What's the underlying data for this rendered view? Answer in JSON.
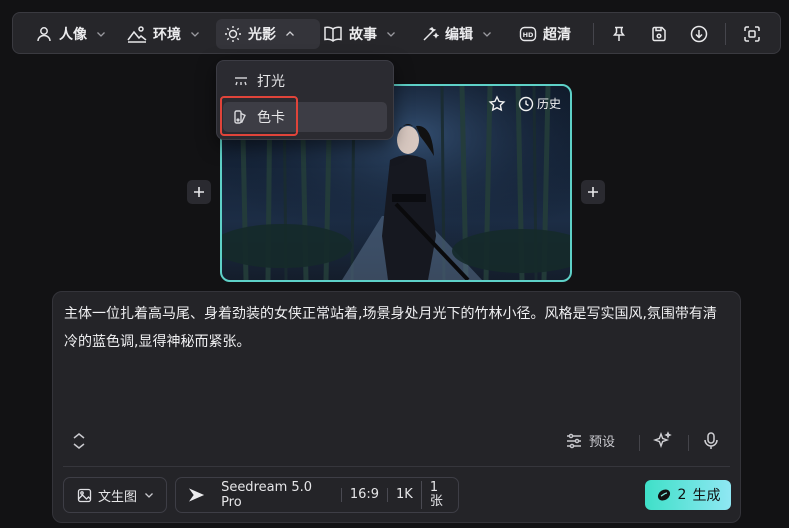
{
  "toolbar": {
    "portrait": "人像",
    "environment": "环境",
    "lighting": "光影",
    "story": "故事",
    "edit": "编辑",
    "hd": "超清"
  },
  "dropdown": {
    "items": [
      "打光",
      "色卡"
    ]
  },
  "image": {
    "history_label": "历史"
  },
  "prompt": {
    "text": "主体一位扎着高马尾、身着劲装的女侠正常站着,场景身处月光下的竹林小径。风格是写实国风,氛围带有清冷的蓝色调,显得神秘而紧张。"
  },
  "controls": {
    "preset_label": "预设",
    "mode_label": "文生图",
    "model_name": "Seedream 5.0 Pro",
    "aspect_ratio": "16:9",
    "resolution": "1K",
    "count": "1张",
    "generate_cost": "2",
    "generate_label": "生成"
  },
  "colors": {
    "accent": "#5ed1c8",
    "highlight": "#e0443a"
  }
}
